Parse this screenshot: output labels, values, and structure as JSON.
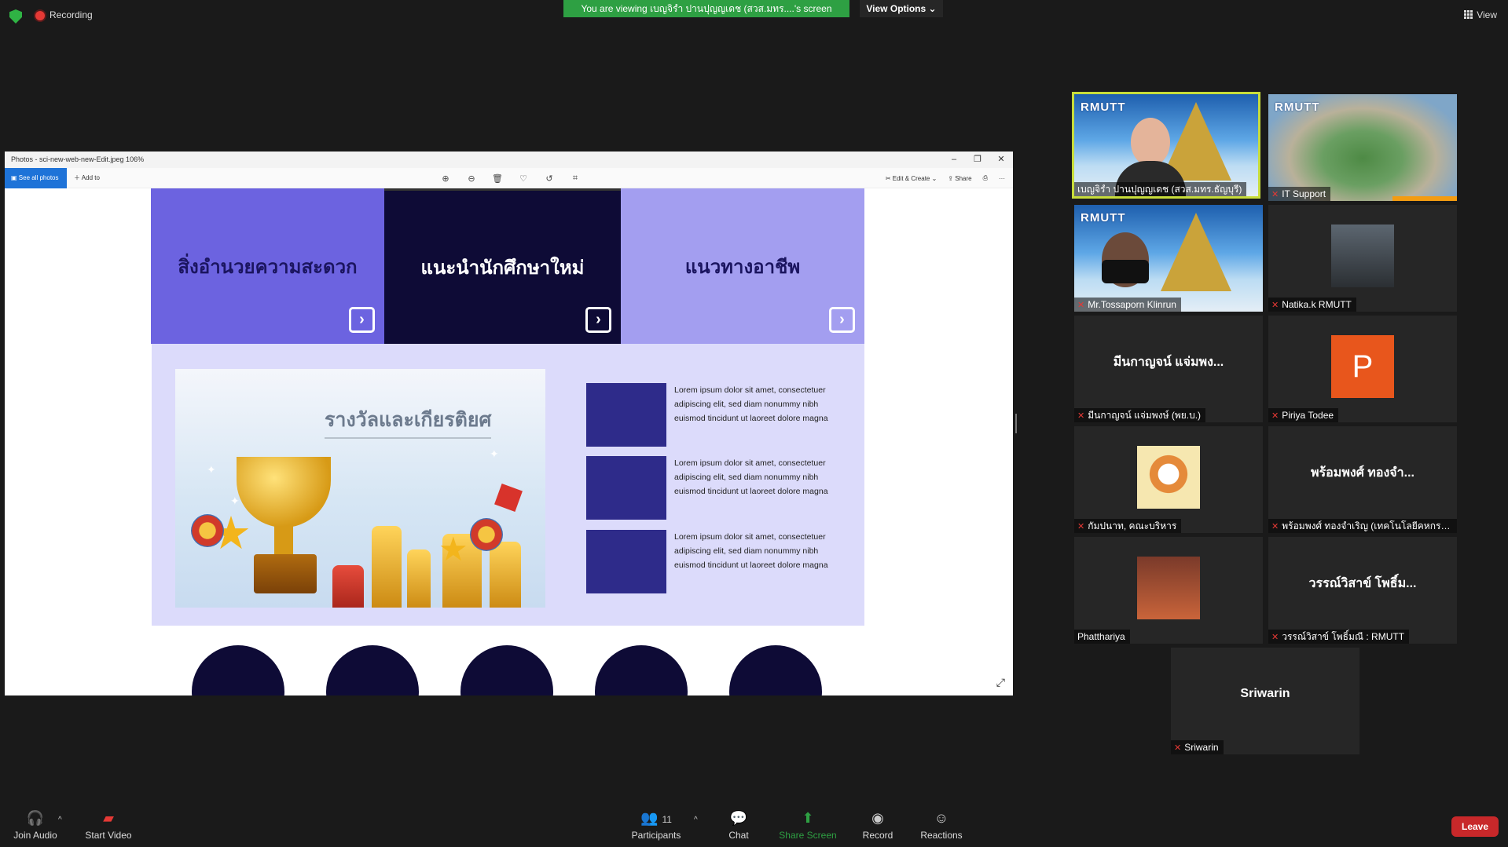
{
  "top": {
    "recording_label": "Recording",
    "viewing_banner": "You are viewing เบญจิรำ ปานปุญญเดช (สวส.มทร....'s screen",
    "view_options_label": "View Options",
    "view_label": "View"
  },
  "photos": {
    "window_title": "Photos - sci-new-web-new-Edit.jpeg   106%",
    "see_all_photos": "See all photos",
    "add_to": "Add to",
    "edit_create": "Edit & Create",
    "share": "Share"
  },
  "slide": {
    "tiles": [
      {
        "label": "สิ่งอำนวยความสะดวก"
      },
      {
        "label": "แนะนำนักศึกษาใหม่"
      },
      {
        "label": "แนวทางอาชีพ"
      }
    ],
    "award_title": "รางวัลและเกียรติยศ",
    "lorem": [
      "Lorem ipsum dolor sit amet, consectetuer adipiscing elit, sed diam nonummy nibh euismod tincidunt ut laoreet dolore magna",
      "Lorem ipsum dolor sit amet, consectetuer adipiscing elit, sed diam nonummy nibh euismod tincidunt ut laoreet dolore magna",
      "Lorem ipsum dolor sit amet, consectetuer adipiscing elit, sed diam nonummy nibh euismod tincidunt ut laoreet dolore magna"
    ]
  },
  "gallery": {
    "participants": [
      {
        "name": "เบญจิรำ ปานปุญญเดช (สวส.มทร.ธัญบุรี)"
      },
      {
        "name": "IT Support"
      },
      {
        "name": "Mr.Tossaporn Klinrun"
      },
      {
        "name": "Natika.k RMUTT"
      },
      {
        "name": "มีนกาญจน์ แจ่มพง...",
        "full_name": "มีนกาญจน์ แจ่มพงษ์ (พย.บ.)"
      },
      {
        "name": "Piriya Todee",
        "initial": "P"
      },
      {
        "name": "กัมปนาท, คณะบริหาร"
      },
      {
        "name": "พร้อมพงศ์ ทองจำ...",
        "full_name": "พร้อมพงศ์ ทองจำเริญ (เทคโนโลยีคหกรรม..."
      },
      {
        "name": "Phatthariya"
      },
      {
        "name": "วรรณ์วิสาข์ โพธิ์ม...",
        "full_name": "วรรณ์วิสาข์ โพธิ์มณี : RMUTT"
      },
      {
        "name": "Sriwarin",
        "full_name": "Sriwarin"
      }
    ],
    "logo_text": "RMUTT"
  },
  "toolbar": {
    "join_audio": "Join Audio",
    "start_video": "Start Video",
    "participants": "Participants",
    "participant_count": "11",
    "chat": "Chat",
    "share_screen": "Share Screen",
    "record": "Record",
    "reactions": "Reactions",
    "leave": "Leave"
  }
}
